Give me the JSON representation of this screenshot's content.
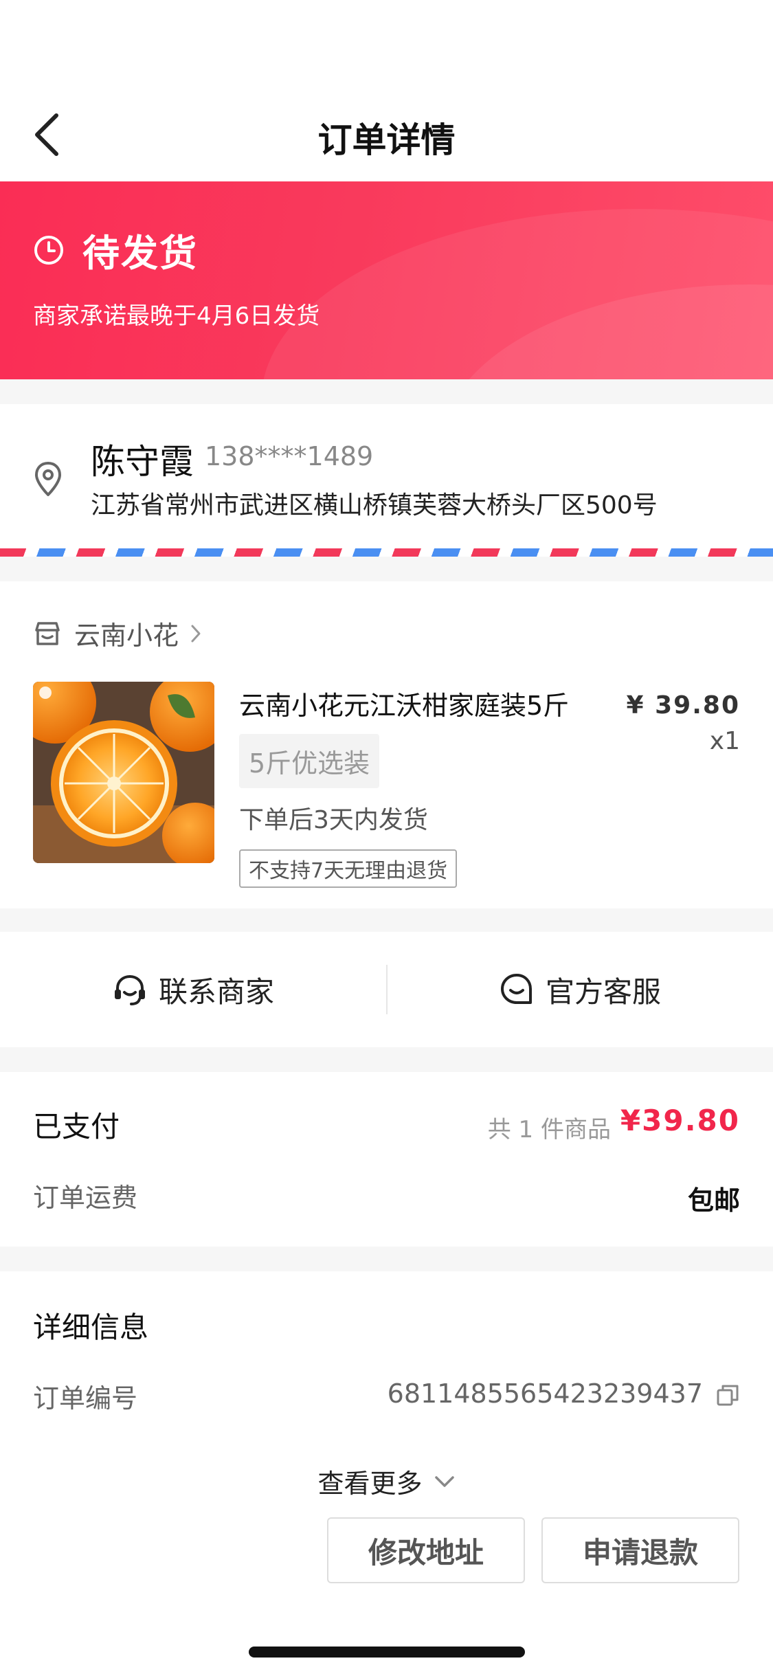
{
  "header": {
    "title": "订单详情",
    "back_icon": "chevron-left-icon"
  },
  "status": {
    "title": "待发货",
    "subtitle": "商家承诺最晚于4月6日发货",
    "icon": "clock-icon",
    "colors": {
      "banner_start": "#fa2d55",
      "banner_end": "#fe4d6a"
    }
  },
  "address": {
    "name": "陈守霞",
    "phone": "138****1489",
    "line": "江苏省常州市武进区横山桥镇芙蓉大桥头厂区500号",
    "icon": "location-pin-icon"
  },
  "shop": {
    "name": "云南小花",
    "icon": "store-icon"
  },
  "product": {
    "title": "云南小花元江沃柑家庭装5斤",
    "price": "¥ 39.80",
    "quantity": "x1",
    "spec": "5斤优选装",
    "shipping_note": "下单后3天内发货",
    "tag": "不支持7天无理由退货",
    "image": "orange-fruit-photo"
  },
  "contact": {
    "merchant_label": "联系商家",
    "merchant_icon": "headset-icon",
    "service_label": "官方客服",
    "service_icon": "chat-smile-icon"
  },
  "payment": {
    "label": "已支付",
    "count_text": "共 1 件商品",
    "total": "¥39.80",
    "shipping_label": "订单运费",
    "shipping_value": "包邮",
    "accent_color": "#f1264b"
  },
  "details": {
    "title": "详细信息",
    "order_label": "订单编号",
    "order_number": "6811485565423239437",
    "copy_icon": "copy-icon",
    "more_label": "查看更多",
    "more_icon": "chevron-down-icon"
  },
  "actions": {
    "modify_label": "修改地址",
    "refund_label": "申请退款"
  }
}
